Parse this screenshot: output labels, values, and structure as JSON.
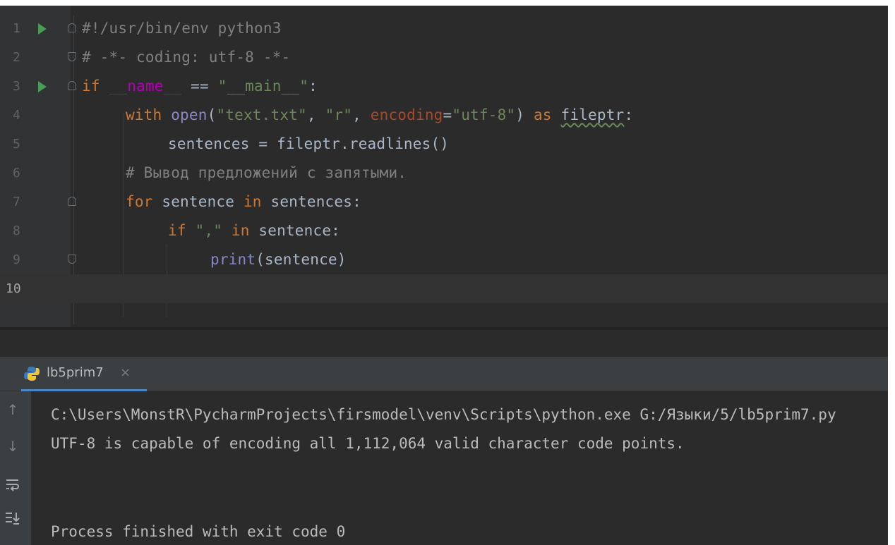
{
  "editor": {
    "lines": [
      {
        "n": "1",
        "segments": [
          {
            "t": "#!/usr/bin/env python3",
            "c": "cmt"
          }
        ]
      },
      {
        "n": "2",
        "segments": [
          {
            "t": "# -*- coding: utf-8 -*-",
            "c": "cmt"
          }
        ]
      },
      {
        "n": "3",
        "segments": [
          {
            "t": "if",
            "c": "kw"
          },
          {
            "t": " "
          },
          {
            "t": "__name__",
            "c": "dn"
          },
          {
            "t": " == "
          },
          {
            "t": "\"__main__\"",
            "c": "str"
          },
          {
            "t": ":"
          }
        ]
      },
      {
        "n": "4",
        "segments": [
          {
            "t": "with",
            "c": "kw"
          },
          {
            "t": " "
          },
          {
            "t": "open",
            "c": "bi"
          },
          {
            "t": "("
          },
          {
            "t": "\"text.txt\"",
            "c": "str"
          },
          {
            "t": ", "
          },
          {
            "t": "\"r\"",
            "c": "str"
          },
          {
            "t": ", "
          },
          {
            "t": "encoding",
            "c": "param"
          },
          {
            "t": "="
          },
          {
            "t": "\"utf-8\"",
            "c": "str"
          },
          {
            "t": ") "
          },
          {
            "t": "as",
            "c": "kw"
          },
          {
            "t": " "
          },
          {
            "t": "fileptr",
            "c": "wavy"
          },
          {
            "t": ":"
          }
        ]
      },
      {
        "n": "5",
        "segments": [
          {
            "t": "sentences = fileptr.readlines()"
          }
        ]
      },
      {
        "n": "6",
        "segments": [
          {
            "t": "# Вывод предложений с запятыми.",
            "c": "cmt"
          }
        ]
      },
      {
        "n": "7",
        "segments": [
          {
            "t": "for",
            "c": "kw"
          },
          {
            "t": " sentence "
          },
          {
            "t": "in",
            "c": "kw"
          },
          {
            "t": " sentences:"
          }
        ]
      },
      {
        "n": "8",
        "segments": [
          {
            "t": "if",
            "c": "kw"
          },
          {
            "t": " "
          },
          {
            "t": "\",\"",
            "c": "str"
          },
          {
            "t": " "
          },
          {
            "t": "in",
            "c": "kw"
          },
          {
            "t": " sentence:"
          }
        ]
      },
      {
        "n": "9",
        "segments": [
          {
            "t": "print",
            "c": "bi"
          },
          {
            "t": "(sentence)"
          }
        ]
      },
      {
        "n": "10",
        "segments": []
      }
    ]
  },
  "run_panel": {
    "tab_label": "lb5prim7",
    "close_glyph": "×",
    "output": [
      "C:\\Users\\MonstR\\PycharmProjects\\firsmodel\\venv\\Scripts\\python.exe G:/Языки/5/lb5prim7.py",
      "UTF-8 is capable of encoding all 1,112,064 valid character code points.",
      "",
      "",
      "Process finished with exit code 0"
    ],
    "toolbar_icons": [
      "up-arrow-icon",
      "down-arrow-icon",
      "soft-wrap-icon",
      "scroll-to-end-icon"
    ]
  },
  "colors": {
    "background": "#2b2b2b",
    "gutter": "#313335",
    "keyword": "#cc7832",
    "string": "#6a8759",
    "comment": "#808080",
    "run_icon": "#499c54",
    "accent": "#4a88c7"
  }
}
